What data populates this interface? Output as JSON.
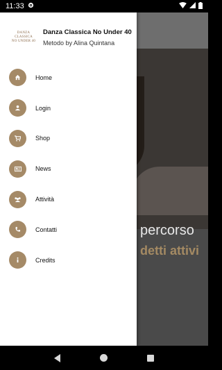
{
  "status_bar": {
    "time": "11:33"
  },
  "drawer": {
    "logo_lines": [
      "DANZA",
      "CLASSICA",
      "NO UNDER 40"
    ],
    "title": "Danza Classica No Under 40",
    "subtitle": "Metodo by Alina Quintana",
    "items": [
      {
        "label": "Home",
        "icon": "home-icon"
      },
      {
        "label": "Login",
        "icon": "person-icon"
      },
      {
        "label": "Shop",
        "icon": "cart-icon"
      },
      {
        "label": "News",
        "icon": "newspaper-icon"
      },
      {
        "label": "Attività",
        "icon": "group-icon"
      },
      {
        "label": "Contatti",
        "icon": "phone-icon"
      },
      {
        "label": "Credits",
        "icon": "info-icon"
      }
    ]
  },
  "background": {
    "text_line1": "percorso",
    "text_line2": "detti attivi"
  },
  "colors": {
    "accent": "#a58a67",
    "drawer_bg": "#ffffff",
    "scrim": "#4a4a4a"
  }
}
